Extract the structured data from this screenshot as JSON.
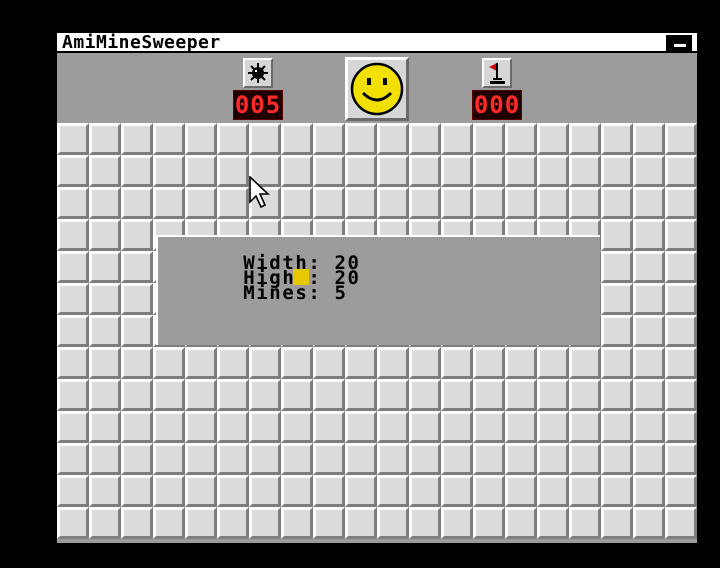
{
  "window": {
    "title": "AmiMineSweeper"
  },
  "header": {
    "mines_counter": "005",
    "flags_counter": "000",
    "mine_icon": "mine-icon",
    "flag_icon": "flag-icon",
    "smiley_icon": "smiley-face-icon"
  },
  "board": {
    "columns": 20,
    "rows": 13,
    "cell_color": "#dcdcdc"
  },
  "settings": {
    "width_label": "Width:",
    "width_value": "20",
    "height_label": "Hight:",
    "height_value": "20",
    "mines_label": "Mines:",
    "mines_value": "5"
  },
  "colors": {
    "led_text": "#ff2a2a",
    "led_bg": "#1e0000",
    "smiley": "#f2e100",
    "cursor": "#e8c800",
    "window_bg": "#9c9c9c"
  }
}
